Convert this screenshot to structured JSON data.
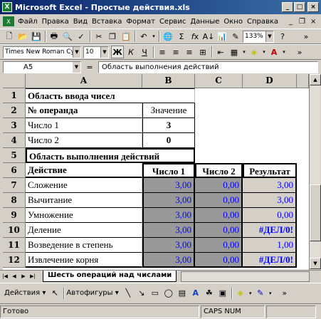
{
  "window": {
    "title": "Microsoft Excel - Простые действия.xls",
    "app_icon": "X"
  },
  "menu": [
    "Файл",
    "Правка",
    "Вид",
    "Вставка",
    "Формат",
    "Сервис",
    "Данные",
    "Окно",
    "Справка"
  ],
  "toolbar_standard": {
    "zoom": "133%"
  },
  "toolbar_format": {
    "font": "Times New Roman Cyr",
    "size": "10"
  },
  "formula_bar": {
    "cell_ref": "A5",
    "fx": "=",
    "content": "Область выполнения действий"
  },
  "columns": [
    "A",
    "B",
    "C",
    "D"
  ],
  "rows": [
    "1",
    "2",
    "3",
    "4",
    "5",
    "6",
    "7",
    "8",
    "9",
    "10",
    "11",
    "12"
  ],
  "cells": {
    "a1": "Область ввода чисел",
    "a2": "№ операнда",
    "b2": "Значение",
    "a3": "Число 1",
    "b3": "3",
    "a4": "Число 2",
    "b4": "0",
    "a5": "Область выполнения действий",
    "a6": "Действие",
    "b6": "Число 1",
    "c6": "Число 2",
    "d6": "Результат",
    "a7": "Сложение",
    "b7": "3,00",
    "c7": "0,00",
    "d7": "3,00",
    "a8": "Вычитание",
    "b8": "3,00",
    "c8": "0,00",
    "d8": "3,00",
    "a9": "Умножение",
    "b9": "3,00",
    "c9": "0,00",
    "d9": "0,00",
    "a10": "Деление",
    "b10": "3,00",
    "c10": "0,00",
    "d10": "#ДЕЛ/0!",
    "a11": "Возведение в степень",
    "b11": "3,00",
    "c11": "0,00",
    "d11": "1,00",
    "a12": "Извлечение корня",
    "b12": "3,00",
    "c12": "0,00",
    "d12": "#ДЕЛ/0!"
  },
  "sheet_tab": "Шесть операций над числами",
  "drawing": {
    "actions": "Действия",
    "autoshapes": "Автофигуры"
  },
  "status": {
    "ready": "Готово",
    "caps": "CAPS NUM"
  }
}
